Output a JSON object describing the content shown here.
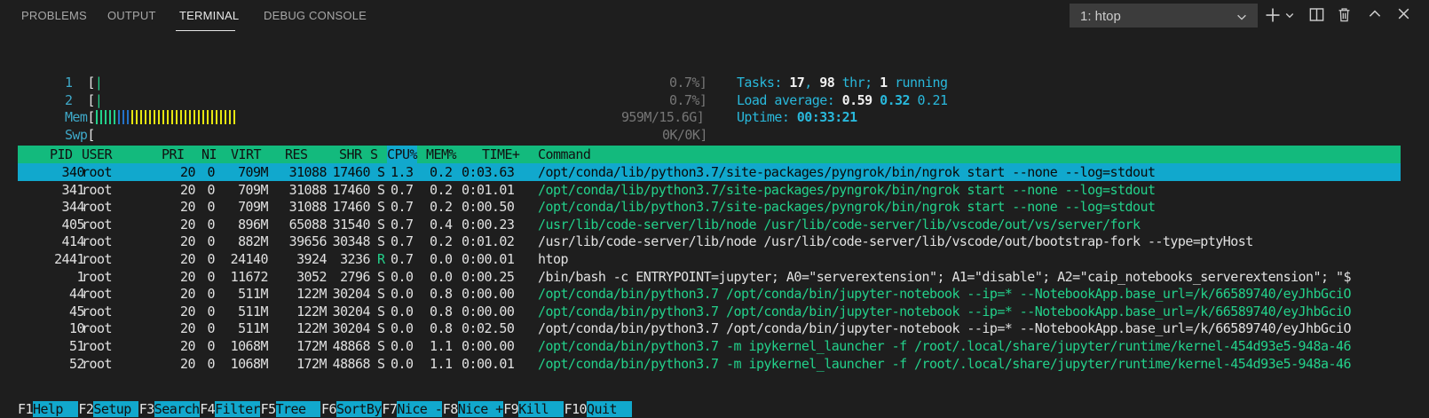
{
  "panel": {
    "tabs": [
      "PROBLEMS",
      "OUTPUT",
      "TERMINAL",
      "DEBUG CONSOLE"
    ],
    "active_tab": "TERMINAL",
    "terminal_selector": "1: htop",
    "icons": [
      "add-icon",
      "chevron-down-icon",
      "split-icon",
      "trash-icon",
      "chevron-up-icon",
      "close-icon"
    ]
  },
  "meters": {
    "cpu1": {
      "label": "1",
      "percent": "0.7%]"
    },
    "cpu2": {
      "label": "2",
      "percent": "0.7%]"
    },
    "mem": {
      "label": "Mem",
      "value": "959M/15.6G]"
    },
    "swp": {
      "label": "Swp",
      "value": "0K/0K]"
    }
  },
  "summary": {
    "tasks_label": "Tasks: ",
    "tasks": "17",
    "thr": "98",
    "thr_label": " thr; ",
    "running": "1",
    "running_label": " running",
    "load_label": "Load average: ",
    "load1": "0.59",
    "load5": "0.32",
    "load15": "0.21",
    "uptime_label": "Uptime: ",
    "uptime": "00:33:21"
  },
  "table": {
    "headers": {
      "pid": "PID",
      "user": "USER",
      "pri": "PRI",
      "ni": "NI",
      "virt": "VIRT",
      "res": "RES",
      "shr": "SHR",
      "s": "S",
      "cpu": "CPU%",
      "mem": "MEM%",
      "time": "TIME+",
      "cmd": "Command"
    },
    "rows": [
      {
        "pid": "340",
        "user": "root",
        "pri": "20",
        "ni": "0",
        "virt": "709M",
        "res": "31088",
        "shr": "17460",
        "s": "S",
        "cpu": "1.3",
        "mem": "0.2",
        "time": "0:03.63",
        "cmd": "/opt/conda/lib/python3.7/site-packages/pyngrok/bin/ngrok start --none --log=stdout",
        "thread": false
      },
      {
        "pid": "341",
        "user": "root",
        "pri": "20",
        "ni": "0",
        "virt": "709M",
        "res": "31088",
        "shr": "17460",
        "s": "S",
        "cpu": "0.7",
        "mem": "0.2",
        "time": "0:01.01",
        "cmd": "/opt/conda/lib/python3.7/site-packages/pyngrok/bin/ngrok start --none --log=stdout",
        "thread": true
      },
      {
        "pid": "344",
        "user": "root",
        "pri": "20",
        "ni": "0",
        "virt": "709M",
        "res": "31088",
        "shr": "17460",
        "s": "S",
        "cpu": "0.7",
        "mem": "0.2",
        "time": "0:00.50",
        "cmd": "/opt/conda/lib/python3.7/site-packages/pyngrok/bin/ngrok start --none --log=stdout",
        "thread": true
      },
      {
        "pid": "405",
        "user": "root",
        "pri": "20",
        "ni": "0",
        "virt": "896M",
        "res": "65088",
        "shr": "31540",
        "s": "S",
        "cpu": "0.7",
        "mem": "0.4",
        "time": "0:00.23",
        "cmd": "/usr/lib/code-server/lib/node /usr/lib/code-server/lib/vscode/out/vs/server/fork",
        "thread": true
      },
      {
        "pid": "414",
        "user": "root",
        "pri": "20",
        "ni": "0",
        "virt": "882M",
        "res": "39656",
        "shr": "30348",
        "s": "S",
        "cpu": "0.7",
        "mem": "0.2",
        "time": "0:01.02",
        "cmd": "/usr/lib/code-server/lib/node /usr/lib/code-server/lib/vscode/out/bootstrap-fork --type=ptyHost",
        "thread": false
      },
      {
        "pid": "2441",
        "user": "root",
        "pri": "20",
        "ni": "0",
        "virt": "24140",
        "res": "3924",
        "shr": "3236",
        "s": "R",
        "cpu": "0.7",
        "mem": "0.0",
        "time": "0:00.01",
        "cmd": "htop",
        "thread": false
      },
      {
        "pid": "1",
        "user": "root",
        "pri": "20",
        "ni": "0",
        "virt": "11672",
        "res": "3052",
        "shr": "2796",
        "s": "S",
        "cpu": "0.0",
        "mem": "0.0",
        "time": "0:00.25",
        "cmd": "/bin/bash -c ENTRYPOINT=jupyter; A0=\"serverextension\"; A1=\"disable\"; A2=\"caip_notebooks_serverextension\"; \"$",
        "thread": false
      },
      {
        "pid": "44",
        "user": "root",
        "pri": "20",
        "ni": "0",
        "virt": "511M",
        "res": "122M",
        "shr": "30204",
        "s": "S",
        "cpu": "0.0",
        "mem": "0.8",
        "time": "0:00.00",
        "cmd": "/opt/conda/bin/python3.7 /opt/conda/bin/jupyter-notebook --ip=* --NotebookApp.base_url=/k/66589740/eyJhbGciO",
        "thread": true
      },
      {
        "pid": "45",
        "user": "root",
        "pri": "20",
        "ni": "0",
        "virt": "511M",
        "res": "122M",
        "shr": "30204",
        "s": "S",
        "cpu": "0.0",
        "mem": "0.8",
        "time": "0:00.00",
        "cmd": "/opt/conda/bin/python3.7 /opt/conda/bin/jupyter-notebook --ip=* --NotebookApp.base_url=/k/66589740/eyJhbGciO",
        "thread": true
      },
      {
        "pid": "10",
        "user": "root",
        "pri": "20",
        "ni": "0",
        "virt": "511M",
        "res": "122M",
        "shr": "30204",
        "s": "S",
        "cpu": "0.0",
        "mem": "0.8",
        "time": "0:02.50",
        "cmd": "/opt/conda/bin/python3.7 /opt/conda/bin/jupyter-notebook --ip=* --NotebookApp.base_url=/k/66589740/eyJhbGciO",
        "thread": false
      },
      {
        "pid": "51",
        "user": "root",
        "pri": "20",
        "ni": "0",
        "virt": "1068M",
        "res": "172M",
        "shr": "48868",
        "s": "S",
        "cpu": "0.0",
        "mem": "1.1",
        "time": "0:00.00",
        "cmd": "/opt/conda/bin/python3.7 -m ipykernel_launcher -f /root/.local/share/jupyter/runtime/kernel-454d93e5-948a-46",
        "thread": true
      },
      {
        "pid": "52",
        "user": "root",
        "pri": "20",
        "ni": "0",
        "virt": "1068M",
        "res": "172M",
        "shr": "48868",
        "s": "S",
        "cpu": "0.0",
        "mem": "1.1",
        "time": "0:00.01",
        "cmd": "/opt/conda/bin/python3.7 -m ipykernel_launcher -f /root/.local/share/jupyter/runtime/kernel-454d93e5-948a-46",
        "thread": true
      }
    ],
    "selected_row": 0
  },
  "function_keys": [
    {
      "key": "F1",
      "action": "Help  "
    },
    {
      "key": "F2",
      "action": "Setup "
    },
    {
      "key": "F3",
      "action": "Search"
    },
    {
      "key": "F4",
      "action": "Filter"
    },
    {
      "key": "F5",
      "action": "Tree  "
    },
    {
      "key": "F6",
      "action": "SortBy"
    },
    {
      "key": "F7",
      "action": "Nice -"
    },
    {
      "key": "F8",
      "action": "Nice +"
    },
    {
      "key": "F9",
      "action": "Kill  "
    },
    {
      "key": "F10",
      "action": "Quit  "
    }
  ],
  "colors": {
    "header_bg": "#13ba7d",
    "selected_bg": "#11a8cd",
    "green_text": "#23d18b",
    "cyan_text": "#29b8db",
    "yellow_bar": "#e5e510",
    "blue_bar": "#2472c8"
  }
}
